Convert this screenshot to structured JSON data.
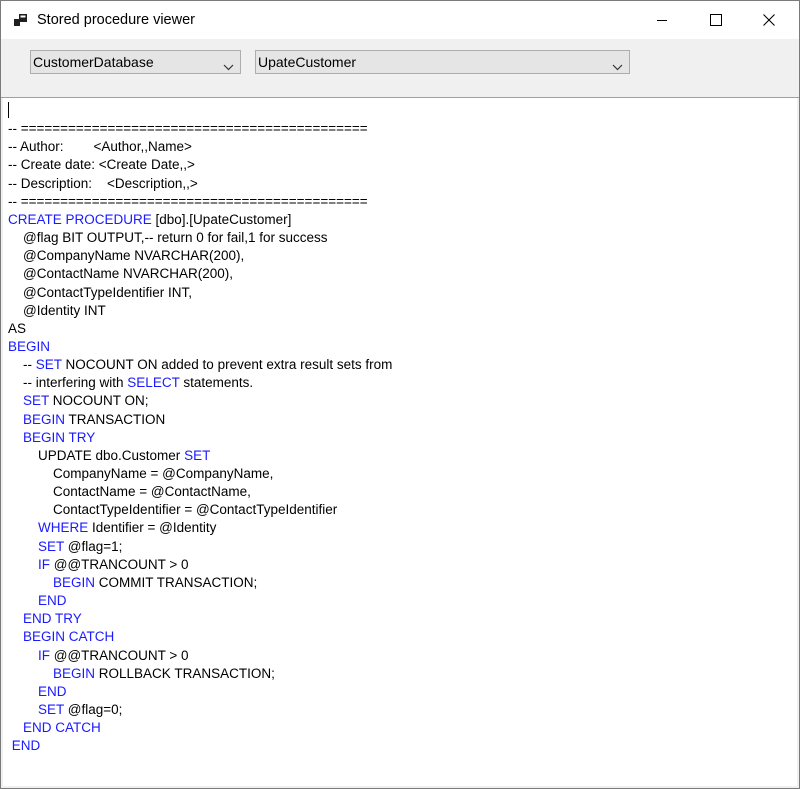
{
  "window": {
    "title": "Stored procedure viewer"
  },
  "toolbar": {
    "database_value": "CustomerDatabase",
    "procedure_value": "UpateCustomer"
  },
  "colors": {
    "keyword": "#1a1aff",
    "text": "#000000",
    "editor_bg": "#ffffff",
    "toolbar_bg": "#f0f0f0"
  },
  "code": {
    "lines": [
      [
        {
          "t": "",
          "k": false
        }
      ],
      [
        {
          "t": "-- ============================================",
          "k": false
        }
      ],
      [
        {
          "t": "-- Author:        <Author,,Name>",
          "k": false
        }
      ],
      [
        {
          "t": "-- Create date: <Create Date,,>",
          "k": false
        }
      ],
      [
        {
          "t": "-- Description:    <Description,,>",
          "k": false
        }
      ],
      [
        {
          "t": "-- ============================================",
          "k": false
        }
      ],
      [
        {
          "t": "CREATE PROCEDURE",
          "k": true
        },
        {
          "t": " [dbo].[UpateCustomer]",
          "k": false
        }
      ],
      [
        {
          "t": "    @flag BIT OUTPUT,-- return 0 for fail,1 for success",
          "k": false
        }
      ],
      [
        {
          "t": "    @CompanyName NVARCHAR(200),",
          "k": false
        }
      ],
      [
        {
          "t": "    @ContactName NVARCHAR(200),",
          "k": false
        }
      ],
      [
        {
          "t": "    @ContactTypeIdentifier INT,",
          "k": false
        }
      ],
      [
        {
          "t": "    @Identity INT",
          "k": false
        }
      ],
      [
        {
          "t": "AS",
          "k": false
        }
      ],
      [
        {
          "t": "BEGIN",
          "k": true
        }
      ],
      [
        {
          "t": "    -- ",
          "k": false
        },
        {
          "t": "SET",
          "k": true
        },
        {
          "t": " NOCOUNT ON added to prevent extra result sets from",
          "k": false
        }
      ],
      [
        {
          "t": "    -- interfering with ",
          "k": false
        },
        {
          "t": "SELECT",
          "k": true
        },
        {
          "t": " statements.",
          "k": false
        }
      ],
      [
        {
          "t": "    ",
          "k": false
        },
        {
          "t": "SET",
          "k": true
        },
        {
          "t": " NOCOUNT ON;",
          "k": false
        }
      ],
      [
        {
          "t": "    ",
          "k": false
        },
        {
          "t": "BEGIN",
          "k": true
        },
        {
          "t": " TRANSACTION",
          "k": false
        }
      ],
      [
        {
          "t": "    ",
          "k": false
        },
        {
          "t": "BEGIN TRY",
          "k": true
        }
      ],
      [
        {
          "t": "        UPDATE dbo.Customer ",
          "k": false
        },
        {
          "t": "SET",
          "k": true
        }
      ],
      [
        {
          "t": "            CompanyName = @CompanyName,",
          "k": false
        }
      ],
      [
        {
          "t": "            ContactName = @ContactName,",
          "k": false
        }
      ],
      [
        {
          "t": "            ContactTypeIdentifier = @ContactTypeIdentifier",
          "k": false
        }
      ],
      [
        {
          "t": "        ",
          "k": false
        },
        {
          "t": "WHERE",
          "k": true
        },
        {
          "t": " Identifier = @Identity",
          "k": false
        }
      ],
      [
        {
          "t": "        ",
          "k": false
        },
        {
          "t": "SET",
          "k": true
        },
        {
          "t": " @flag=1;",
          "k": false
        }
      ],
      [
        {
          "t": "        ",
          "k": false
        },
        {
          "t": "IF",
          "k": true
        },
        {
          "t": " @@TRANCOUNT > 0",
          "k": false
        }
      ],
      [
        {
          "t": "            ",
          "k": false
        },
        {
          "t": "BEGIN",
          "k": true
        },
        {
          "t": " COMMIT TRANSACTION;",
          "k": false
        }
      ],
      [
        {
          "t": "        ",
          "k": false
        },
        {
          "t": "END",
          "k": true
        }
      ],
      [
        {
          "t": "    ",
          "k": false
        },
        {
          "t": "END TRY",
          "k": true
        }
      ],
      [
        {
          "t": "    ",
          "k": false
        },
        {
          "t": "BEGIN CATCH",
          "k": true
        }
      ],
      [
        {
          "t": "        ",
          "k": false
        },
        {
          "t": "IF",
          "k": true
        },
        {
          "t": " @@TRANCOUNT > 0",
          "k": false
        }
      ],
      [
        {
          "t": "            ",
          "k": false
        },
        {
          "t": "BEGIN",
          "k": true
        },
        {
          "t": " ROLLBACK TRANSACTION;",
          "k": false
        }
      ],
      [
        {
          "t": "        ",
          "k": false
        },
        {
          "t": "END",
          "k": true
        }
      ],
      [
        {
          "t": "        ",
          "k": false
        },
        {
          "t": "SET",
          "k": true
        },
        {
          "t": " @flag=0;",
          "k": false
        }
      ],
      [
        {
          "t": "    ",
          "k": false
        },
        {
          "t": "END CATCH",
          "k": true
        }
      ],
      [
        {
          "t": " ",
          "k": false
        },
        {
          "t": "END",
          "k": true
        }
      ]
    ]
  }
}
